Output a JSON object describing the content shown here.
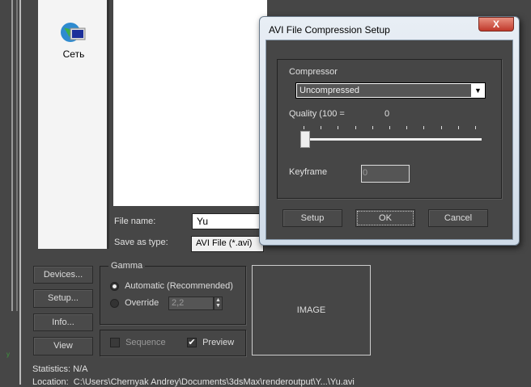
{
  "sidebar": {
    "network_label": "Сеть"
  },
  "file_dialog": {
    "file_name_label": "File name:",
    "file_name_value": "Yu",
    "save_as_type_label": "Save as type:",
    "save_as_type_value": "AVI File (*.avi)"
  },
  "buttons": {
    "devices": "Devices...",
    "setup": "Setup...",
    "info": "Info...",
    "view": "View"
  },
  "gamma": {
    "title": "Gamma",
    "automatic": "Automatic (Recommended)",
    "override": "Override",
    "override_value": "2,2",
    "selected": "automatic"
  },
  "options": {
    "sequence": "Sequence",
    "sequence_checked": false,
    "preview": "Preview",
    "preview_checked": true
  },
  "image_placeholder": "IMAGE",
  "statistics": "Statistics: N/A",
  "location": "Location:  C:\\Users\\Chernyak Andrey\\Documents\\3dsMax\\renderoutput\\Y...\\Yu.avi",
  "avi_dialog": {
    "title": "AVI File Compression Setup",
    "close": "X",
    "compressor_label": "Compressor",
    "compressor_value": "Uncompressed",
    "quality_label": "Quality (100 =",
    "quality_value": "0",
    "quality_fraction": 0,
    "keyframe_label": "Keyframe",
    "keyframe_value": "0",
    "setup": "Setup",
    "ok": "OK",
    "cancel": "Cancel"
  }
}
